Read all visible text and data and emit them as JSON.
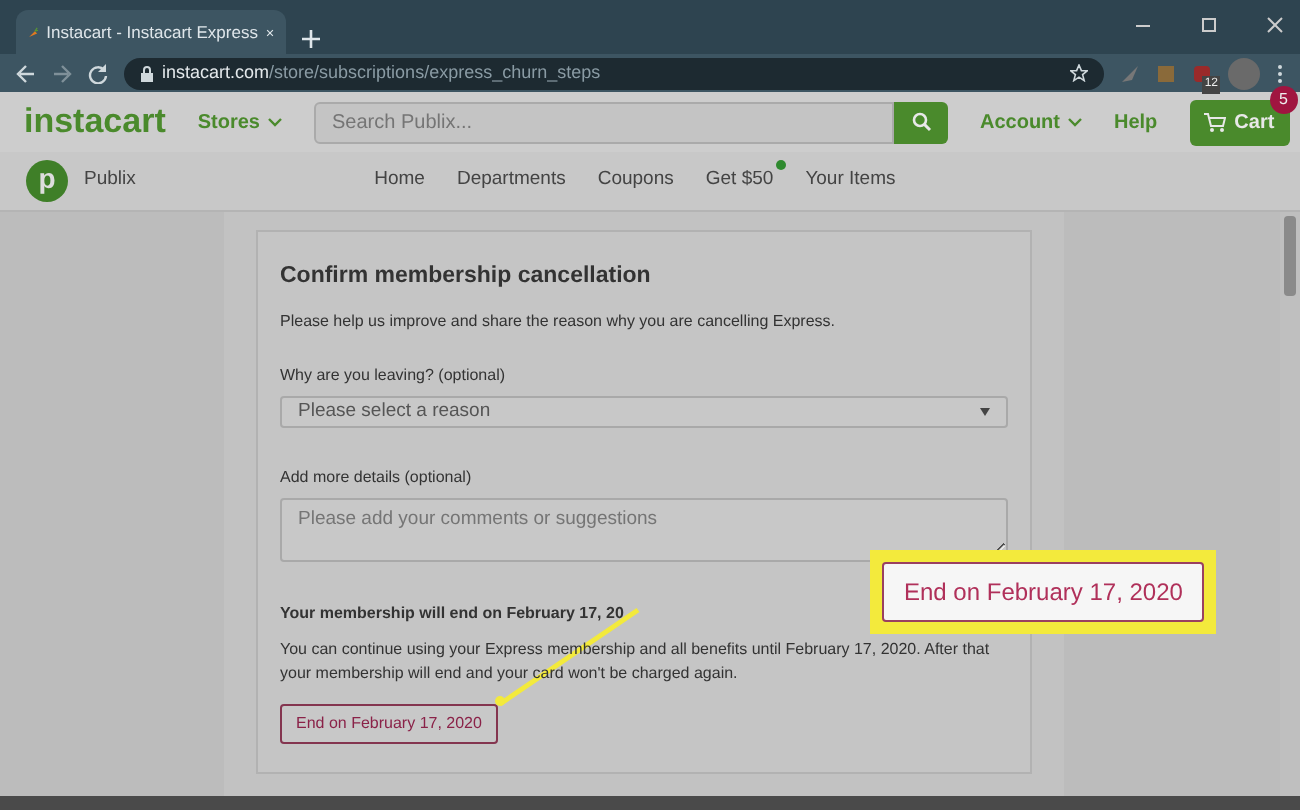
{
  "browser": {
    "tab": {
      "title": "Instacart - Instacart Express"
    },
    "url": {
      "host": "instacart.com",
      "path": "/store/subscriptions/express_churn_steps"
    },
    "extension_badge": "12"
  },
  "header": {
    "logo": "instacart",
    "stores": "Stores",
    "search": {
      "placeholder": "Search Publix..."
    },
    "account": "Account",
    "help": "Help",
    "cart": {
      "label": "Cart",
      "count": "5"
    }
  },
  "store": {
    "initial": "p",
    "name": "Publix"
  },
  "nav": [
    {
      "label": "Home",
      "dot": false
    },
    {
      "label": "Departments",
      "dot": false
    },
    {
      "label": "Coupons",
      "dot": false
    },
    {
      "label": "Get $50",
      "dot": true
    },
    {
      "label": "Your Items",
      "dot": false
    }
  ],
  "form": {
    "title": "Confirm membership cancellation",
    "intro": "Please help us improve and share the reason why you are cancelling Express.",
    "reason_label": "Why are you leaving? (optional)",
    "reason_value": "Please select a reason",
    "details_label": "Add more details (optional)",
    "details_placeholder": "Please add your comments or suggestions",
    "end_heading": "Your membership will end on February 17, 20",
    "end_text": "You can continue using your Express membership and all benefits until February 17, 2020. After that your membership will end and your card won't be charged again.",
    "end_button": "End on February 17, 2020"
  },
  "callout": {
    "label": "End on February 17, 2020"
  }
}
